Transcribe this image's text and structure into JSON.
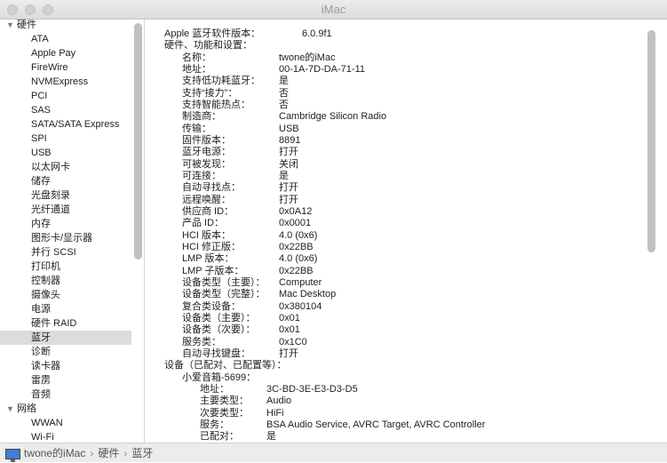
{
  "window": {
    "title": "iMac"
  },
  "sidebar": {
    "items": [
      {
        "label": "硬件",
        "group": true
      },
      {
        "label": "ATA"
      },
      {
        "label": "Apple Pay"
      },
      {
        "label": "FireWire"
      },
      {
        "label": "NVMExpress"
      },
      {
        "label": "PCI"
      },
      {
        "label": "SAS"
      },
      {
        "label": "SATA/SATA Express"
      },
      {
        "label": "SPI"
      },
      {
        "label": "USB"
      },
      {
        "label": "以太网卡"
      },
      {
        "label": "储存"
      },
      {
        "label": "光盘刻录"
      },
      {
        "label": "光纤通道"
      },
      {
        "label": "内存"
      },
      {
        "label": "图形卡/显示器"
      },
      {
        "label": "并行 SCSI"
      },
      {
        "label": "打印机"
      },
      {
        "label": "控制器"
      },
      {
        "label": "摄像头"
      },
      {
        "label": "电源"
      },
      {
        "label": "硬件 RAID"
      },
      {
        "label": "蓝牙",
        "selected": true
      },
      {
        "label": "诊断"
      },
      {
        "label": "读卡器"
      },
      {
        "label": "雷雳"
      },
      {
        "label": "音频"
      },
      {
        "label": "网络",
        "group": true
      },
      {
        "label": "WWAN"
      },
      {
        "label": "Wi-Fi"
      }
    ]
  },
  "content": {
    "rows": [
      {
        "l": "Apple 蓝牙软件版本：",
        "v": "6.0.9f1",
        "lvl": 0,
        "wide": true
      },
      {
        "l": "硬件、功能和设置：",
        "v": "",
        "lvl": 0
      },
      {
        "l": "名称：",
        "v": "twone的iMac",
        "lvl": 1
      },
      {
        "l": "地址：",
        "v": "00-1A-7D-DA-71-11",
        "lvl": 1
      },
      {
        "l": "支持低功耗蓝牙：",
        "v": "是",
        "lvl": 1
      },
      {
        "l": "支持“接力”：",
        "v": "否",
        "lvl": 1
      },
      {
        "l": "支持智能热点：",
        "v": "否",
        "lvl": 1
      },
      {
        "l": "制造商：",
        "v": "Cambridge Silicon Radio",
        "lvl": 1
      },
      {
        "l": "传输：",
        "v": "USB",
        "lvl": 1
      },
      {
        "l": "固件版本：",
        "v": "8891",
        "lvl": 1
      },
      {
        "l": "蓝牙电源：",
        "v": "打开",
        "lvl": 1
      },
      {
        "l": "可被发现：",
        "v": "关闭",
        "lvl": 1
      },
      {
        "l": "可连接：",
        "v": "是",
        "lvl": 1
      },
      {
        "l": "自动寻找点：",
        "v": "打开",
        "lvl": 1
      },
      {
        "l": "远程唤醒：",
        "v": "打开",
        "lvl": 1
      },
      {
        "l": "供应商 ID：",
        "v": "0x0A12",
        "lvl": 1
      },
      {
        "l": "产品 ID：",
        "v": "0x0001",
        "lvl": 1
      },
      {
        "l": "HCI 版本：",
        "v": "4.0 (0x6)",
        "lvl": 1
      },
      {
        "l": "HCI 修正版：",
        "v": "0x22BB",
        "lvl": 1
      },
      {
        "l": "LMP 版本：",
        "v": "4.0 (0x6)",
        "lvl": 1
      },
      {
        "l": "LMP 子版本：",
        "v": "0x22BB",
        "lvl": 1
      },
      {
        "l": "设备类型（主要）：",
        "v": "Computer",
        "lvl": 1
      },
      {
        "l": "设备类型（完整）：",
        "v": "Mac Desktop",
        "lvl": 1
      },
      {
        "l": "复合类设备：",
        "v": "0x380104",
        "lvl": 1
      },
      {
        "l": "设备类（主要）：",
        "v": "0x01",
        "lvl": 1
      },
      {
        "l": "设备类（次要）：",
        "v": "0x01",
        "lvl": 1
      },
      {
        "l": "服务类：",
        "v": "0x1C0",
        "lvl": 1
      },
      {
        "l": "自动寻找键盘：",
        "v": "打开",
        "lvl": 1
      },
      {
        "l": "设备（已配对、已配置等）：",
        "v": "",
        "lvl": 0
      },
      {
        "l": "小爱音箱-5699：",
        "v": "",
        "lvl": 1
      },
      {
        "l": "地址：",
        "v": "3C-BD-3E-E3-D3-D5",
        "lvl": 2
      },
      {
        "l": "主要类型：",
        "v": "Audio",
        "lvl": 2
      },
      {
        "l": "次要类型：",
        "v": "HiFi",
        "lvl": 2
      },
      {
        "l": "服务：",
        "v": "BSA Audio Service, AVRC Target, AVRC Controller",
        "lvl": 2
      },
      {
        "l": "已配对：",
        "v": "是",
        "lvl": 2
      }
    ]
  },
  "status": {
    "path": [
      "twone的iMac",
      "硬件",
      "蓝牙"
    ],
    "separator": "›"
  }
}
